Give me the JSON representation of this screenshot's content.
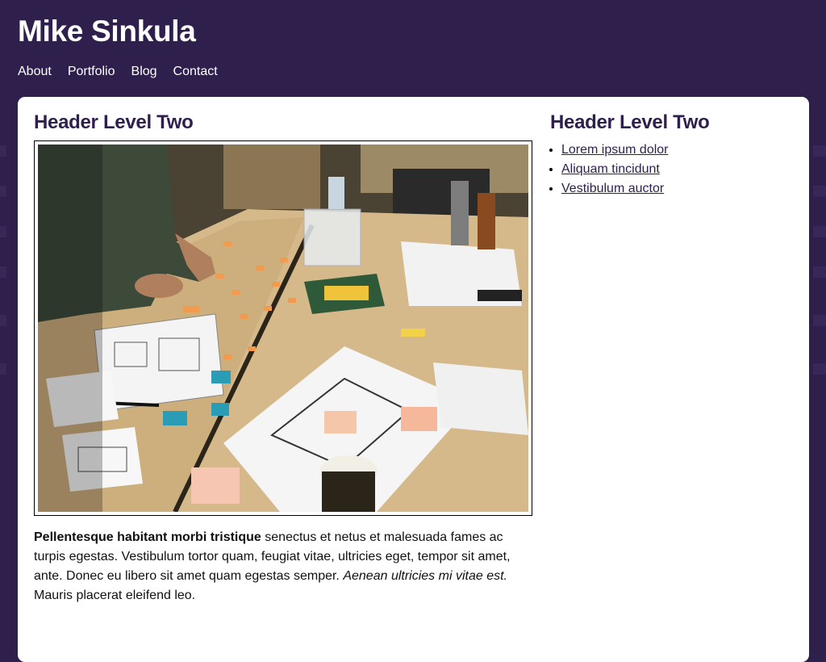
{
  "site": {
    "title": "Mike Sinkula",
    "nav": [
      "About",
      "Portfolio",
      "Blog",
      "Contact"
    ]
  },
  "main": {
    "heading": "Header Level Two",
    "paragraph": {
      "bold": "Pellentesque habitant morbi tristique",
      "text1": " senectus et netus et malesuada fames ac turpis egestas. Vestibulum tortor quam, feugiat vitae, ultricies eget, tempor sit amet, ante. Donec eu libero sit amet quam egestas semper. ",
      "italic": "Aenean ultricies mi vitae est.",
      "text2": " Mauris placerat eleifend leo."
    }
  },
  "sidebar": {
    "heading": "Header Level Two",
    "links": [
      "Lorem ipsum dolor",
      "Aliquam tincidunt",
      "Vestibulum auctor"
    ]
  },
  "colors": {
    "background": "#2e1f4d",
    "panel": "#ffffff",
    "heading": "#2e1f4d",
    "link": "#2e1f4d"
  },
  "icons": {
    "photo": "paper-prototyping-photo"
  }
}
